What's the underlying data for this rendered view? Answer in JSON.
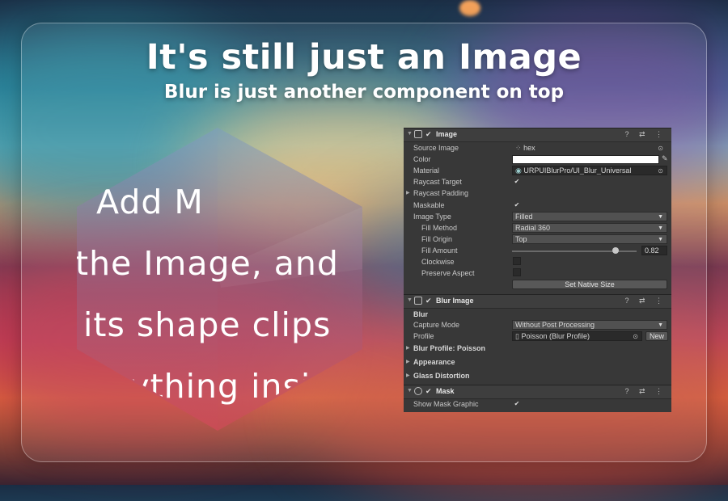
{
  "headline": {
    "title": "It's still just an Image",
    "subtitle": "Blur is just another component on top"
  },
  "demo_text_lines": [
    "Add M",
    "the Image, and",
    "its shape clips",
    "verything insid"
  ],
  "colors": {
    "inspector_bg": "#383838",
    "shape_top": "#6e8fb5",
    "shape_bottom": "#c2455c",
    "text": "#ffffff"
  },
  "inspector": {
    "image": {
      "name": "Image",
      "icon": "image-component-icon",
      "enabled": true,
      "rows": {
        "source_image": {
          "label": "Source Image",
          "value": "hex"
        },
        "color": {
          "label": "Color",
          "value": "#ffffff"
        },
        "material": {
          "label": "Material",
          "value": "URPUIBlurPro/UI_Blur_Universal"
        },
        "raycast_target": {
          "label": "Raycast Target",
          "checked": true
        },
        "raycast_padding": {
          "label": "Raycast Padding"
        },
        "maskable": {
          "label": "Maskable",
          "checked": true
        },
        "image_type": {
          "label": "Image Type",
          "value": "Filled"
        },
        "fill_method": {
          "label": "Fill Method",
          "value": "Radial 360"
        },
        "fill_origin": {
          "label": "Fill Origin",
          "value": "Top"
        },
        "fill_amount": {
          "label": "Fill Amount",
          "value": "0.82",
          "fraction": 0.82
        },
        "clockwise": {
          "label": "Clockwise",
          "checked": false
        },
        "preserve_aspect": {
          "label": "Preserve Aspect",
          "checked": false
        },
        "set_native_size": "Set Native Size"
      }
    },
    "blur_image": {
      "name": "Blur Image",
      "icon": "blur-image-component-icon",
      "section": "Blur",
      "capture_mode": {
        "label": "Capture Mode",
        "value": "Without Post Processing"
      },
      "profile": {
        "label": "Profile",
        "value": "Poisson (Blur Profile)",
        "new_label": "New"
      },
      "foldouts": [
        "Blur Profile: Poisson",
        "Appearance",
        "Glass Distortion"
      ]
    },
    "mask": {
      "name": "Mask",
      "icon": "mask-component-icon",
      "enabled": true,
      "show_mask_graphic": {
        "label": "Show Mask Graphic",
        "checked": true
      }
    },
    "header_icons": "? ⇄ ⋮"
  }
}
